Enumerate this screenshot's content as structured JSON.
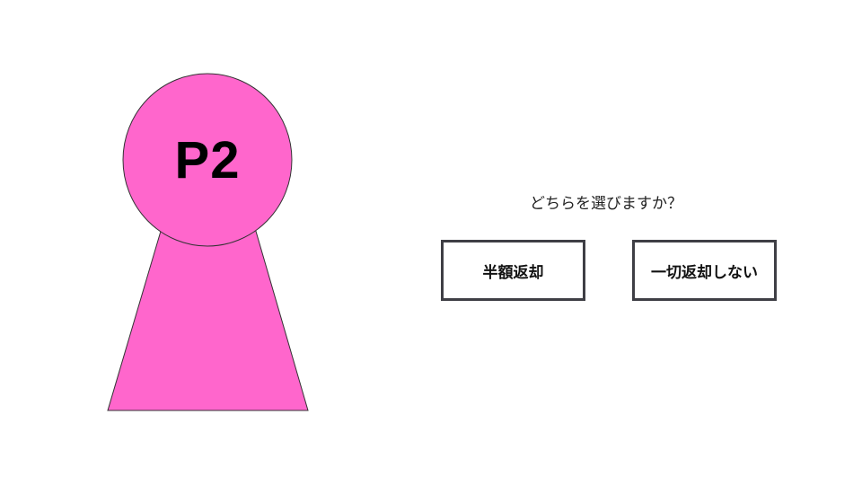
{
  "player": {
    "label": "P2",
    "color": "#ff66cc",
    "outline_color": "#333333"
  },
  "prompt": {
    "question": "どちらを選びますか？"
  },
  "choices": [
    {
      "label": "半額返却"
    },
    {
      "label": "一切返却しない"
    }
  ]
}
